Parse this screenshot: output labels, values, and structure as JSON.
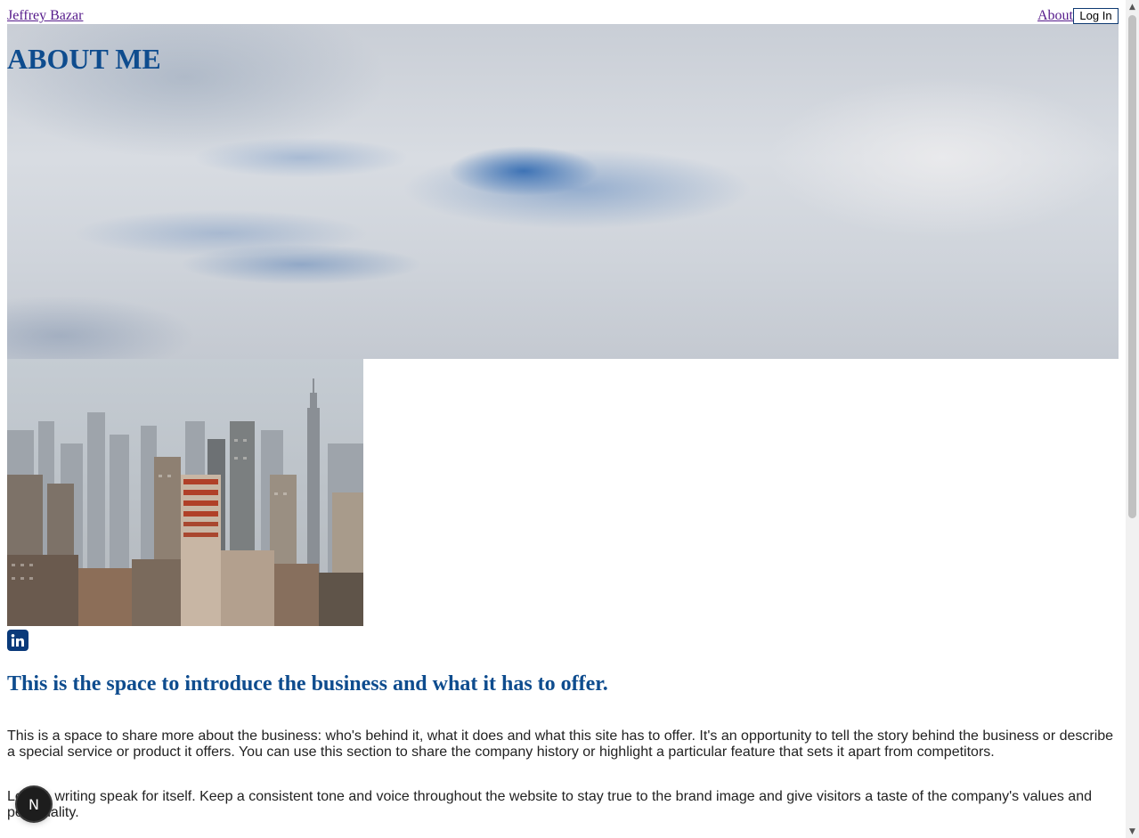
{
  "header": {
    "site_name": "Jeffrey Bazar",
    "nav_about": "About",
    "login_label": "Log In"
  },
  "hero": {
    "title": "ABOUT ME"
  },
  "social": {
    "icon": "linkedin-icon",
    "brand_color": "#0a3a7a"
  },
  "content": {
    "headline": "This is the space to introduce the business and what it has to offer.",
    "paragraph_1": "This is a space to share more about the business: who's behind it, what it does and what this site has to offer. It's an opportunity to tell the story behind the business or describe a special service or product it offers. You can use this section to share the company history or highlight a particular feature that sets it apart from competitors.",
    "paragraph_2": "Let the writing speak for itself. Keep a consistent tone and voice throughout the website to stay true to the brand image and give visitors a taste of the company's values and personality."
  },
  "badge": {
    "letter": "N"
  },
  "colors": {
    "accent": "#0e4c8e",
    "link_visited": "#551a8b"
  }
}
